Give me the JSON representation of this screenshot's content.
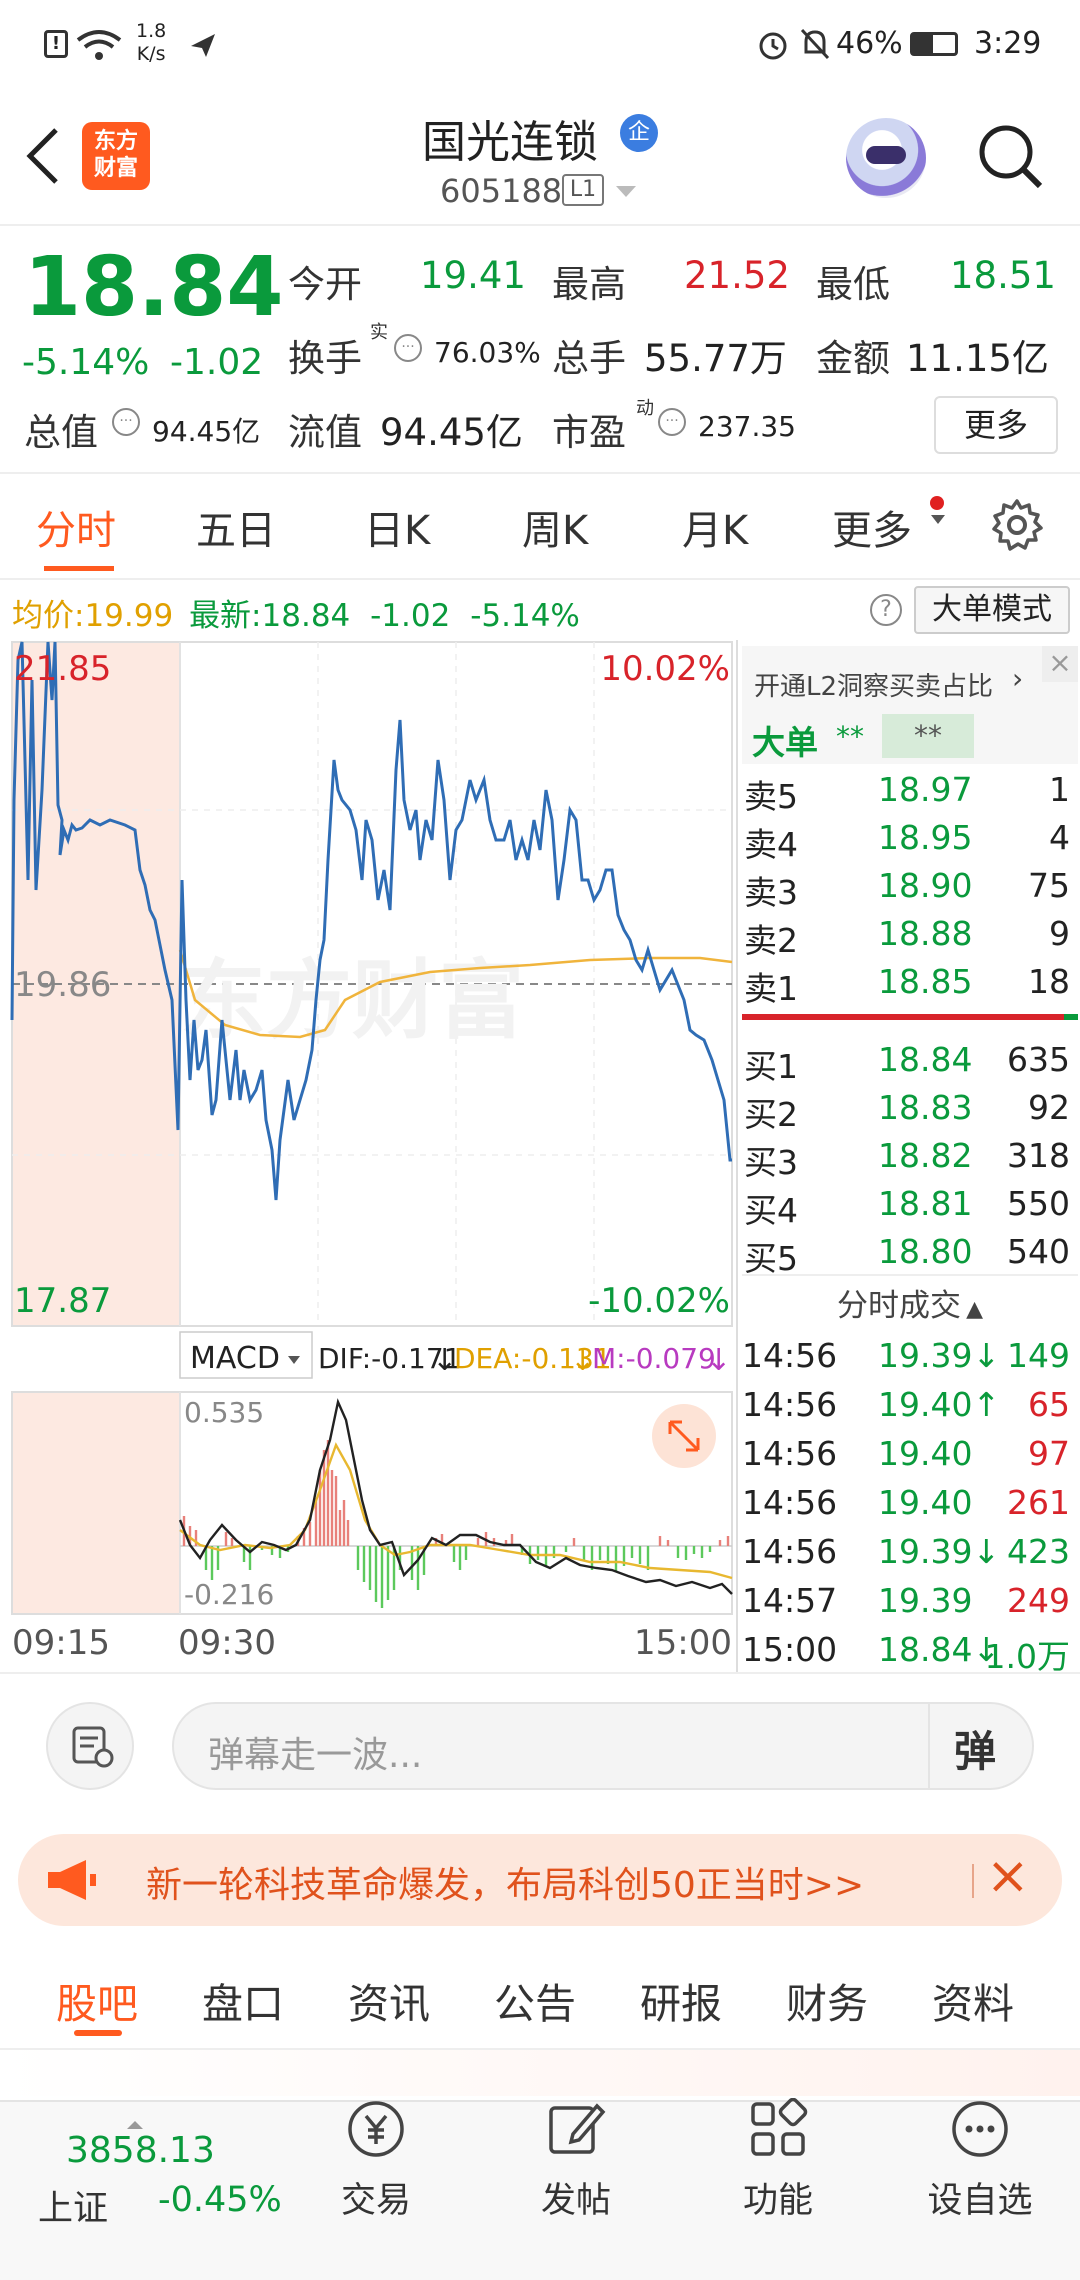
{
  "status_bar": {
    "speed": "1.8",
    "speed_unit": "K/s",
    "battery": "46%",
    "time": "3:29"
  },
  "header": {
    "logo": "东方\n财富",
    "stock_name": "国光连锁",
    "badge": "企",
    "code": "605188",
    "level": "L1"
  },
  "quote": {
    "price": "18.84",
    "change_pct": "-5.14%",
    "change": "-1.02",
    "open_label": "今开",
    "open": "19.41",
    "high_label": "最高",
    "high": "21.52",
    "low_label": "最低",
    "low": "18.51",
    "turnover_label": "换手",
    "turnover_sup": "实",
    "turnover": "76.03%",
    "volume_label": "总手",
    "volume": "55.77万",
    "amount_label": "金额",
    "amount": "11.15亿",
    "mktcap_label": "总值",
    "mktcap": "94.45亿",
    "float_label": "流值",
    "float_cap": "94.45亿",
    "pe_label": "市盈",
    "pe_sup": "动",
    "pe": "237.35",
    "more": "更多"
  },
  "tabs": [
    "分时",
    "五日",
    "日K",
    "周K",
    "月K",
    "更多"
  ],
  "info_line": {
    "avg_label": "均价:",
    "avg": "19.99",
    "last_label": "最新:",
    "last": "18.84",
    "chg": "-1.02",
    "pct": "-5.14%",
    "mode_button": "大单模式"
  },
  "chart": {
    "top_price": "21.85",
    "mid_price": "19.86",
    "bottom_price": "17.87",
    "top_pct": "10.02%",
    "bottom_pct": "-10.02%",
    "watermark": "东方财富"
  },
  "macd": {
    "label": "MACD",
    "dif": "DIF:-0.171",
    "dea": "DEA:-0.131",
    "m": "M:-0.079",
    "top": "0.535",
    "bottom": "-0.216"
  },
  "time_axis": [
    "09:15",
    "09:30",
    "15:00"
  ],
  "orderbook": {
    "promo": "开通L2洞察买卖占比",
    "big_label": "大单",
    "big_val1": "**",
    "big_val2": "**",
    "asks": [
      {
        "l": "卖5",
        "p": "18.97",
        "v": "1"
      },
      {
        "l": "卖4",
        "p": "18.95",
        "v": "4"
      },
      {
        "l": "卖3",
        "p": "18.90",
        "v": "75"
      },
      {
        "l": "卖2",
        "p": "18.88",
        "v": "9"
      },
      {
        "l": "卖1",
        "p": "18.85",
        "v": "18"
      }
    ],
    "bids": [
      {
        "l": "买1",
        "p": "18.84",
        "v": "635"
      },
      {
        "l": "买2",
        "p": "18.83",
        "v": "92"
      },
      {
        "l": "买3",
        "p": "18.82",
        "v": "318"
      },
      {
        "l": "买4",
        "p": "18.81",
        "v": "550"
      },
      {
        "l": "买5",
        "p": "18.80",
        "v": "540"
      }
    ]
  },
  "trades": {
    "title": "分时成交",
    "rows": [
      {
        "t": "14:56",
        "p": "19.39↓",
        "v": "149"
      },
      {
        "t": "14:56",
        "p": "19.40↑",
        "v": "65"
      },
      {
        "t": "14:56",
        "p": "19.40",
        "v": "97"
      },
      {
        "t": "14:56",
        "p": "19.40",
        "v": "261"
      },
      {
        "t": "14:56",
        "p": "19.39↓",
        "v": "423"
      },
      {
        "t": "14:57",
        "p": "19.39",
        "v": "249"
      },
      {
        "t": "15:00",
        "p": "18.84↓",
        "v": "1.0万"
      }
    ]
  },
  "danmu": {
    "placeholder": "弹幕走一波...",
    "button": "弹"
  },
  "banner": {
    "text": "新一轮科技革命爆发，布局科创50正当时>>"
  },
  "bottom_tabs": [
    "股吧",
    "盘口",
    "资讯",
    "公告",
    "研报",
    "财务",
    "资料"
  ],
  "bottom_nav": {
    "index_value": "3858.13",
    "index_name": "上证",
    "index_pct": "-0.45%",
    "items": [
      "交易",
      "发帖",
      "功能",
      "设自选"
    ]
  },
  "colors": {
    "up": "#d8232a",
    "down": "#0a9a3c",
    "accent": "#ff5a1f",
    "line": "#2f6db5",
    "avg": "#f0b43c"
  }
}
